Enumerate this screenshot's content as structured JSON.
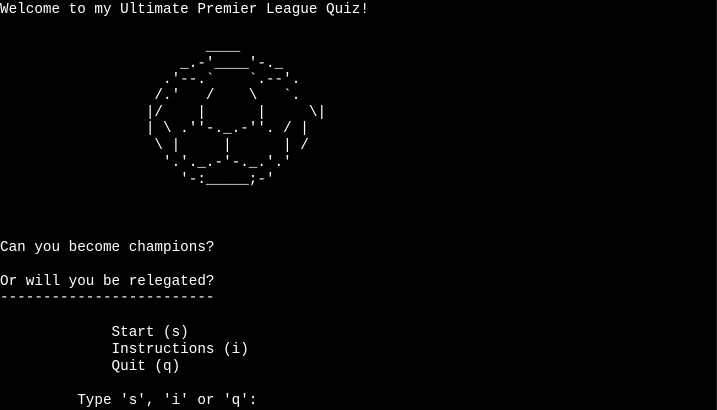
{
  "terminal": {
    "welcome_line": "Welcome to my Ultimate Premier League Quiz!",
    "football_art": [
      "                        ____",
      "                     _.-'____'-._",
      "                   .'--.`    `.--'.",
      "                  /.'   /    \\   `.",
      "                 |/    |      |     \\|",
      "                 | \\ .''-._.-''. / |",
      "                  \\ |     |      | /",
      "                   '.'._.-'-._.'.'",
      "                     '-:_____;-'"
    ],
    "tagline_1": "Can you become champions?",
    "tagline_2": "Or will you be relegated?",
    "divider": "-------------------------",
    "menu": {
      "start": "             Start (s)",
      "instructions": "             Instructions (i)",
      "quit": "             Quit (q)"
    },
    "prompt": "         Type 's', 'i' or 'q':"
  },
  "colors": {
    "background": "#000000",
    "text": "#ffffff"
  }
}
